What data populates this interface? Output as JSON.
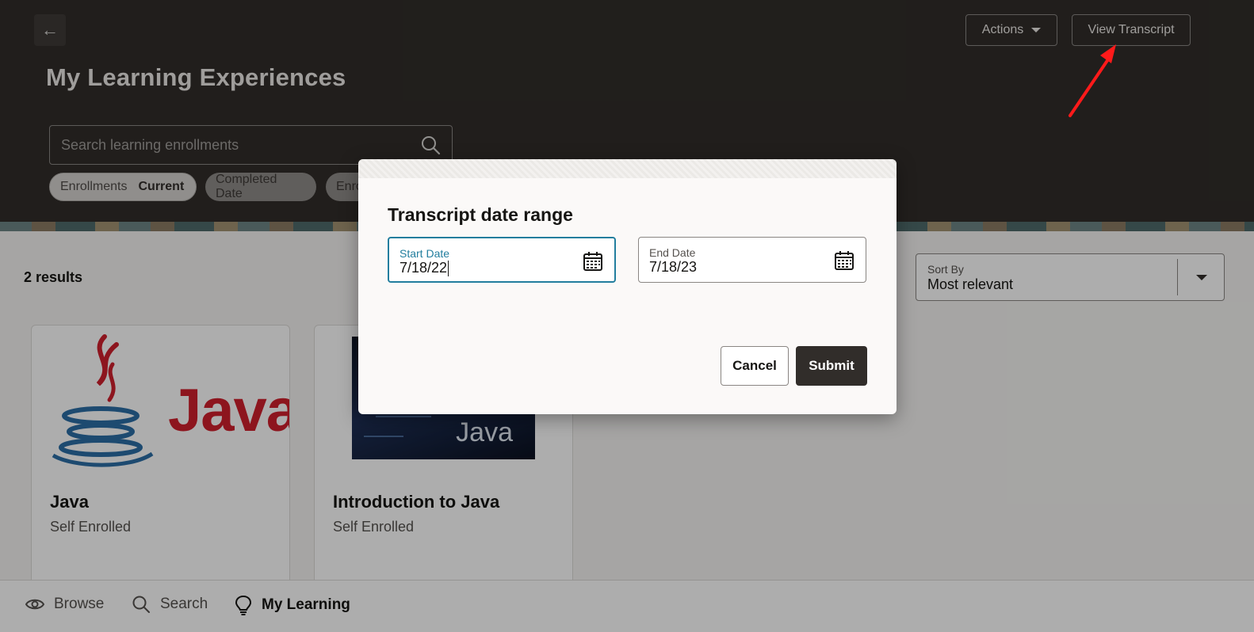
{
  "header": {
    "title": "My Learning Experiences",
    "actions_label": "Actions",
    "view_transcript_label": "View Transcript",
    "search_placeholder": "Search learning enrollments",
    "filters": [
      {
        "label": "Enrollments",
        "value": "Current"
      },
      {
        "label": "Completed Date"
      },
      {
        "label": "Enro"
      }
    ]
  },
  "content": {
    "results": "2 results",
    "sort": {
      "label": "Sort By",
      "value": "Most relevant"
    },
    "cards": [
      {
        "title": "Java",
        "subtitle": "Self Enrolled",
        "logo_text": "Java"
      },
      {
        "title": "Introduction to Java",
        "subtitle": "Self Enrolled",
        "image_text": "Java"
      }
    ]
  },
  "nav": {
    "browse": "Browse",
    "search": "Search",
    "my_learning": "My Learning"
  },
  "dialog": {
    "title": "Transcript date range",
    "start_date": {
      "label": "Start Date",
      "value": "7/18/22"
    },
    "end_date": {
      "label": "End Date",
      "value": "7/18/23"
    },
    "cancel_label": "Cancel",
    "submit_label": "Submit"
  },
  "colors": {
    "header_bg": "#312d2a",
    "focus_border": "#227e9e",
    "primary_button": "#312d2a",
    "java_red": "#d0202d",
    "java_blue": "#2c6ea6",
    "annotation_arrow": "#ff1a1a"
  },
  "icons": [
    "back-arrow-icon",
    "chevron-down-icon",
    "search-icon",
    "calendar-icon",
    "eye-icon",
    "lightbulb-icon"
  ]
}
